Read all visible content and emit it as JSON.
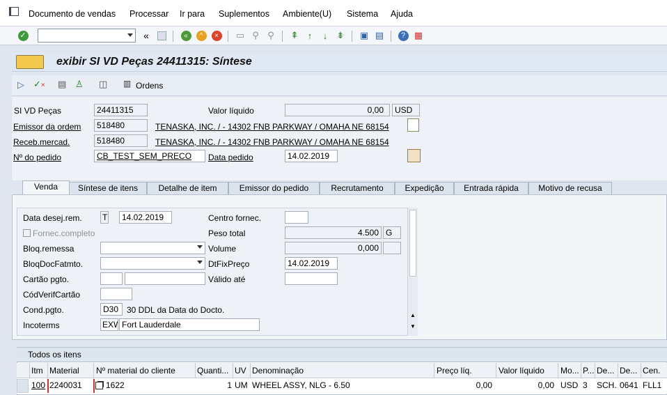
{
  "menu": {
    "items": [
      "Documento de vendas",
      "Processar",
      "Ir para",
      "Suplementos",
      "Ambiente(U)",
      "Sistema",
      "Ajuda"
    ]
  },
  "toolbar": {
    "command_value": ""
  },
  "title": "exibir SI VD Peças 24411315: Síntese",
  "app_toolbar": {
    "orders_label": "Ordens"
  },
  "header": {
    "si_vd_label": "SI VD Peças",
    "si_vd_value": "24411315",
    "valor_liquido_label": "Valor líquido",
    "valor_liquido_value": "0,00",
    "currency": "USD",
    "emissor_label": "Emissor da ordem",
    "emissor_value": "518480",
    "emissor_desc": "TENASKA, INC. / - 14302 FNB PARKWAY / OMAHA NE 68154",
    "receb_label": "Receb.mercad.",
    "receb_value": "518480",
    "receb_desc": "TENASKA, INC. / - 14302 FNB PARKWAY / OMAHA NE 68154",
    "pedido_label": "Nº do pedido",
    "pedido_value": "CB_TEST_SEM_PRECO",
    "data_pedido_label": "Data pedido",
    "data_pedido_value": "14.02.2019"
  },
  "tabs": [
    "Venda",
    "Síntese de itens",
    "Detalhe de item",
    "Emissor do pedido",
    "Recrutamento",
    "Expedição",
    "Entrada rápida",
    "Motivo de recusa"
  ],
  "venda": {
    "data_desej_label": "Data desej.rem.",
    "data_desej_type": "T",
    "data_desej_value": "14.02.2019",
    "centro_label": "Centro fornec.",
    "centro_value": "",
    "fornec_completo_label": "Fornec.completo",
    "peso_label": "Peso total",
    "peso_value": "4.500",
    "peso_unit": "G",
    "bloq_remessa_label": "Bloq.remessa",
    "volume_label": "Volume",
    "volume_value": "0,000",
    "bloq_doc_label": "BloqDocFatmto.",
    "dtfix_label": "DtFixPreço",
    "dtfix_value": "14.02.2019",
    "cartao_label": "Cartão pgto.",
    "valido_label": "Válido até",
    "codverif_label": "CódVerifCartão",
    "cond_label": "Cond.pgto.",
    "cond_code": "D30",
    "cond_desc": "30 DDL da Data do Docto.",
    "incoterms_label": "Incoterms",
    "incoterms_code": "EXW",
    "incoterms_desc": "Fort Lauderdale"
  },
  "items_table": {
    "title": "Todos os itens",
    "columns": [
      "Itm",
      "Material",
      "Nº material do cliente",
      "Quanti...",
      "UV",
      "Denominação",
      "Preço líq.",
      "Valor líquido",
      "Mo...",
      "P...",
      "De...",
      "De...",
      "Cen."
    ],
    "rows": [
      {
        "itm": "100",
        "material": "2240031",
        "cliente": "1622",
        "qty": "1",
        "uv": "UM",
        "denom": "WHEEL ASSY, NLG - 6.50",
        "preco": "0,00",
        "valor": "0,00",
        "moeda": "USD",
        "p": "3",
        "de1": "SCH...",
        "de2": "0641",
        "cen": "FLL1"
      }
    ]
  },
  "colors": {
    "accent_blue": "#0a58a8",
    "header_bg": "#dfe8f3"
  }
}
